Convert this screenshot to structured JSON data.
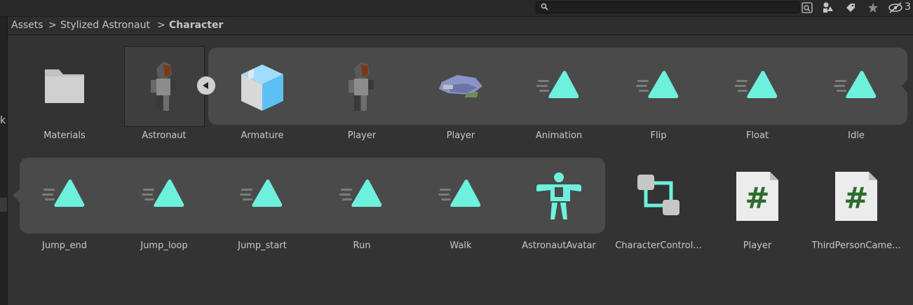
{
  "toolbar": {
    "search_value": "",
    "hidden_count": "3",
    "icons": [
      "search-icon",
      "search-maximize-icon",
      "filter-by-type-icon",
      "filter-by-label-icon",
      "favorite-star-icon",
      "hidden-packages-icon"
    ]
  },
  "sidebar": {
    "partial_label": "k"
  },
  "breadcrumb": {
    "items": [
      "Assets",
      "Stylized Astronaut",
      "Character"
    ],
    "separator": ">"
  },
  "assets": [
    {
      "label": "Materials",
      "type": "folder"
    },
    {
      "label": "Astronaut",
      "type": "model",
      "selected": true,
      "expanded": true
    },
    {
      "label": "Armature",
      "type": "prefab"
    },
    {
      "label": "Player",
      "type": "mesh"
    },
    {
      "label": "Player",
      "type": "mesh-preview"
    },
    {
      "label": "Animation",
      "type": "animation-clip"
    },
    {
      "label": "Flip",
      "type": "animation-clip"
    },
    {
      "label": "Float",
      "type": "animation-clip"
    },
    {
      "label": "Idle",
      "type": "animation-clip"
    },
    {
      "label": "Jump_end",
      "type": "animation-clip"
    },
    {
      "label": "Jump_loop",
      "type": "animation-clip"
    },
    {
      "label": "Jump_start",
      "type": "animation-clip"
    },
    {
      "label": "Run",
      "type": "animation-clip"
    },
    {
      "label": "Walk",
      "type": "animation-clip"
    },
    {
      "label": "AstronautAvatar",
      "type": "avatar"
    },
    {
      "label": "CharacterControl...",
      "type": "animator-controller"
    },
    {
      "label": "Player",
      "type": "csharp-script"
    },
    {
      "label": "ThirdPersonCame...",
      "type": "csharp-script"
    }
  ],
  "colors": {
    "accent_teal": "#6ef1dc",
    "script_green": "#2e6b2e",
    "panel": "#4a4a4a",
    "background": "#333333"
  }
}
